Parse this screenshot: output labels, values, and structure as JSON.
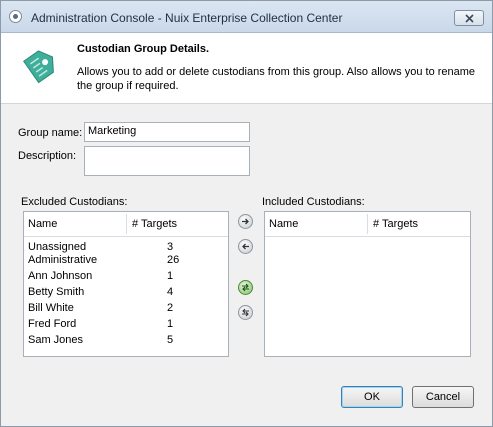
{
  "window": {
    "title": "Administration Console - Nuix Enterprise Collection Center"
  },
  "header": {
    "title": "Custodian Group Details.",
    "description": "Allows you to add or delete custodians from this group. Also allows you to rename the group if required.",
    "icon": "tag-icon",
    "accent_color": "#3fae9a"
  },
  "form": {
    "group_name_label": "Group name:",
    "group_name_value": "Marketing",
    "description_label": "Description:",
    "description_value": ""
  },
  "excluded": {
    "label": "Excluded Custodians:",
    "columns": [
      "Name",
      "# Targets"
    ],
    "rows": [
      {
        "name": "Unassigned",
        "targets": "3"
      },
      {
        "name": "Administrative",
        "targets": "26"
      },
      {
        "name": "Ann Johnson",
        "targets": "1"
      },
      {
        "name": "Betty Smith",
        "targets": "4"
      },
      {
        "name": "Bill White",
        "targets": "2"
      },
      {
        "name": "Fred Ford",
        "targets": "1"
      },
      {
        "name": "Sam Jones",
        "targets": "5"
      }
    ]
  },
  "included": {
    "label": "Included Custodians:",
    "columns": [
      "Name",
      "# Targets"
    ],
    "rows": []
  },
  "move_buttons": [
    "move-right-icon",
    "move-left-icon",
    "move-all-right-icon",
    "move-all-left-icon"
  ],
  "footer": {
    "ok_label": "OK",
    "cancel_label": "Cancel"
  }
}
